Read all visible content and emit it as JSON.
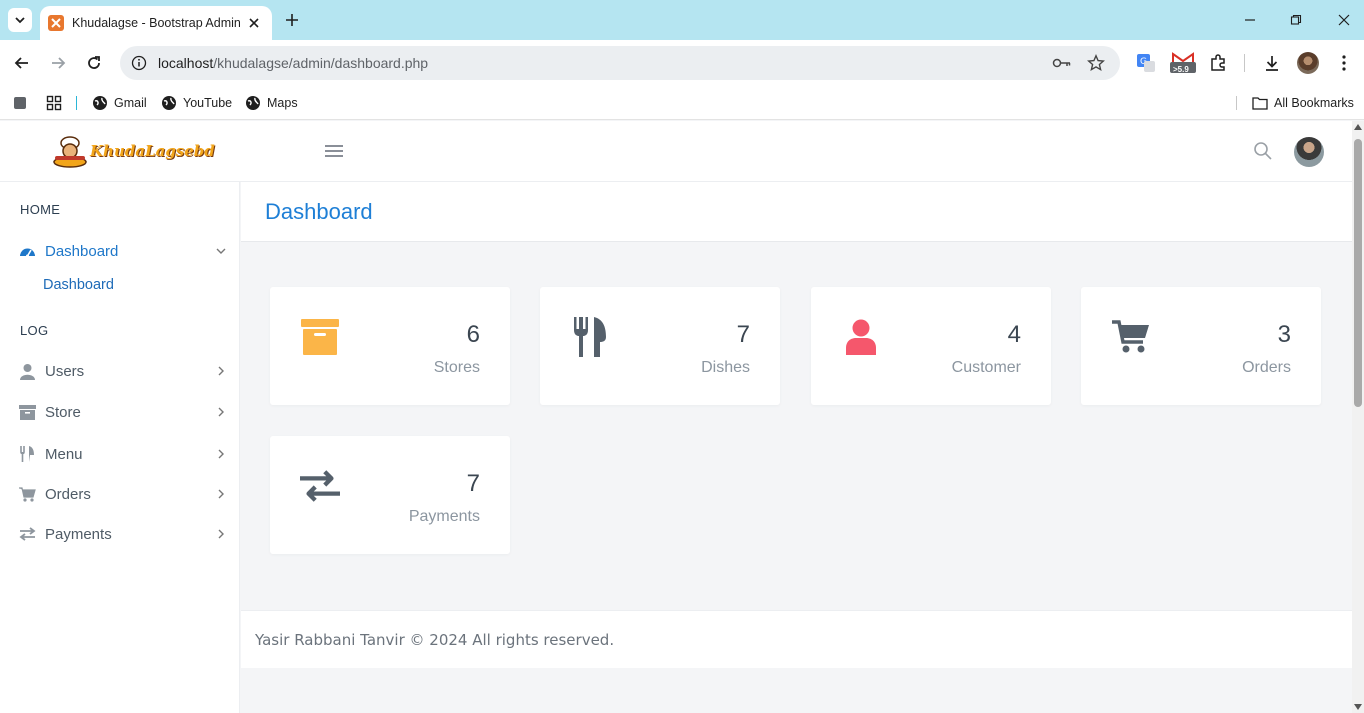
{
  "browser": {
    "tab_title": "Khudalagse - Bootstrap Admin",
    "url_host": "localhost",
    "url_path": "/khudalagse/admin/dashboard.php",
    "extension_badge": ">5.9",
    "bookmarks": [
      "Gmail",
      "YouTube",
      "Maps"
    ],
    "all_bookmarks": "All Bookmarks"
  },
  "header": {
    "logo_text": "KhudaLagsebd"
  },
  "sidebar": {
    "section_home": "HOME",
    "dashboard": "Dashboard",
    "dashboard_sub": "Dashboard",
    "section_log": "LOG",
    "items": [
      {
        "label": "Users",
        "icon": "user-icon"
      },
      {
        "label": "Store",
        "icon": "archive-icon"
      },
      {
        "label": "Menu",
        "icon": "utensils-icon"
      },
      {
        "label": "Orders",
        "icon": "cart-icon"
      },
      {
        "label": "Payments",
        "icon": "exchange-icon"
      }
    ]
  },
  "page": {
    "title": "Dashboard"
  },
  "cards": [
    {
      "value": "6",
      "label": "Stores",
      "icon": "archive-icon",
      "color": "#fbb548"
    },
    {
      "value": "7",
      "label": "Dishes",
      "icon": "utensils-icon",
      "color": "#55606b"
    },
    {
      "value": "4",
      "label": "Customer",
      "icon": "user-icon",
      "color": "#f5576c"
    },
    {
      "value": "3",
      "label": "Orders",
      "icon": "cart-icon",
      "color": "#55606b"
    },
    {
      "value": "7",
      "label": "Payments",
      "icon": "exchange-icon",
      "color": "#55606b"
    }
  ],
  "footer": {
    "text": "Yasir Rabbani Tanvir © 2024 All rights reserved."
  },
  "colors": {
    "accent": "#1e7fd6",
    "tabbar": "#b5e5f1"
  }
}
